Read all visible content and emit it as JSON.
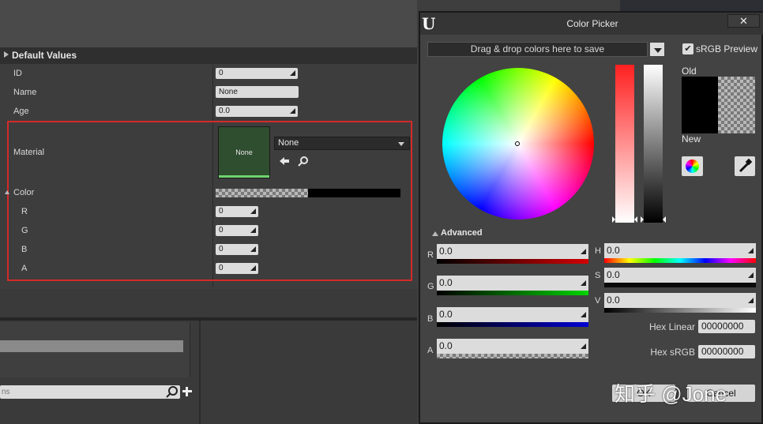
{
  "details": {
    "header": "Default Values",
    "rows": [
      {
        "label": "ID",
        "value": "0"
      },
      {
        "label": "Name",
        "value": "None"
      },
      {
        "label": "Age",
        "value": "0.0"
      },
      {
        "label": "Material"
      },
      {
        "label": "Color"
      },
      {
        "label": "R",
        "value": "0"
      },
      {
        "label": "G",
        "value": "0"
      },
      {
        "label": "B",
        "value": "0"
      },
      {
        "label": "A",
        "value": "0"
      }
    ],
    "material": {
      "thumb_label": "None",
      "combo_value": "None"
    },
    "highlight_color": "#d42a2a"
  },
  "bottom": {
    "search_placeholder": "ns"
  },
  "picker": {
    "title": "Color Picker",
    "close_label": "✕",
    "logo_glyph": "U",
    "save_bar_label": "Drag & drop colors here to save",
    "srgb_checked": "✔",
    "srgb_label": "sRGB Preview",
    "old_label": "Old",
    "new_label": "New",
    "advanced_label": "Advanced",
    "rgb": [
      {
        "label": "R",
        "value": "0.0"
      },
      {
        "label": "G",
        "value": "0.0"
      },
      {
        "label": "B",
        "value": "0.0"
      },
      {
        "label": "A",
        "value": "0.0"
      }
    ],
    "hsv": [
      {
        "label": "H",
        "value": "0.0"
      },
      {
        "label": "S",
        "value": "0.0"
      },
      {
        "label": "V",
        "value": "0.0"
      }
    ],
    "hex_linear_label": "Hex Linear",
    "hex_linear_value": "00000000",
    "hex_srgb_label": "Hex sRGB",
    "hex_srgb_value": "00000000",
    "ok_label": "OK",
    "cancel_label": "Cancel"
  },
  "watermark": "知乎 @Jone"
}
